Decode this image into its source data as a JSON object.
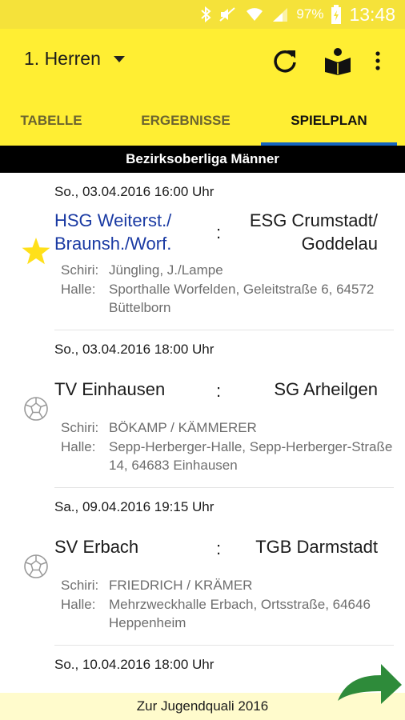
{
  "status": {
    "battery": "97%",
    "time": "13:48"
  },
  "appbar": {
    "team": "1. Herren"
  },
  "tabs": [
    {
      "label": "TABELLE"
    },
    {
      "label": "ERGEBNISSE"
    },
    {
      "label": "SPIELPLAN"
    }
  ],
  "active_tab": "SPIELPLAN",
  "league": "Bezirksoberliga Männer",
  "labels": {
    "referee": "Schiri:",
    "hall": "Halle:",
    "colon": ":"
  },
  "games": [
    {
      "date": "So., 03.04.2016  16:00 Uhr",
      "home": "HSG Weiterst./ Braunsh./Worf.",
      "away": "ESG Crumstadt/ Goddelau",
      "referee": "Jüngling, J./Lampe",
      "hall": "Sporthalle Worfelden, Geleitstraße 6, 64572  Büttelborn",
      "marker": "star-icon"
    },
    {
      "date": "So., 03.04.2016  18:00 Uhr",
      "home": "TV Einhausen",
      "away": "SG Arheilgen",
      "referee": "BÖKAMP / KÄMMERER",
      "hall": "Sepp-Herberger-Halle, Sepp-Herberger-Straße 14, 64683  Einhausen",
      "marker": "handball-icon"
    },
    {
      "date": "Sa., 09.04.2016  19:15 Uhr",
      "home": "SV Erbach",
      "away": "TGB Darmstadt",
      "referee": "FRIEDRICH / KRÄMER",
      "hall": "Mehrzweckhalle Erbach, Ortsstraße, 64646  Heppenheim",
      "marker": "handball-icon"
    },
    {
      "date": "So., 10.04.2016  18:00 Uhr"
    }
  ],
  "footer": {
    "link": "Zur Jugendquali 2016"
  },
  "colors": {
    "appbar": "#ffee33",
    "favorite": "#1a3aa3",
    "tab_indicator": "#1565c0",
    "arrow": "#2e8b3a",
    "star": "#ffe019"
  }
}
